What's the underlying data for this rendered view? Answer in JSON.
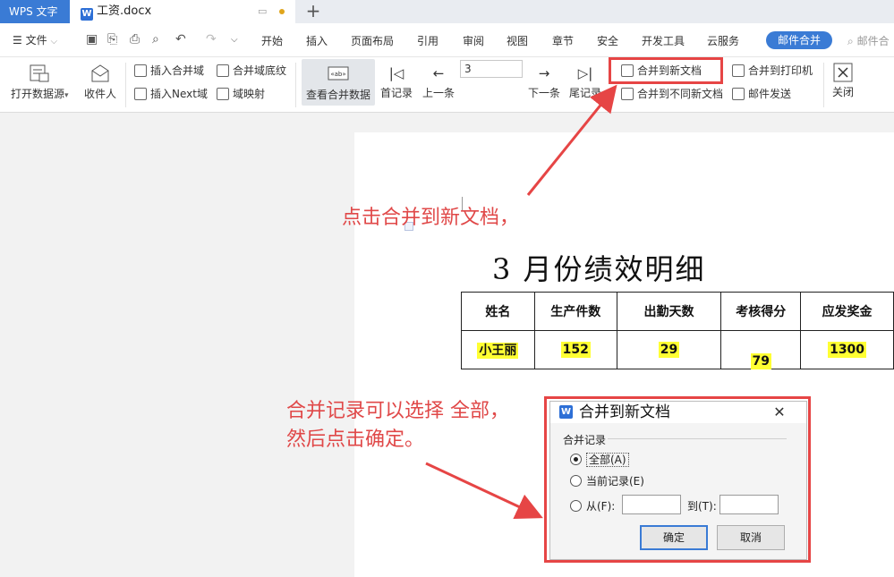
{
  "titlebar": {
    "app_name": "WPS 文字",
    "doc_tab": "工资.docx",
    "new_tab": "+"
  },
  "menubar": {
    "file_label": "文件",
    "items": [
      "开始",
      "插入",
      "页面布局",
      "引用",
      "审阅",
      "视图",
      "章节",
      "安全",
      "开发工具",
      "云服务"
    ],
    "active_tab": "邮件合并",
    "search_placeholder": "邮件合"
  },
  "ribbon": {
    "open_data_source": "打开数据源",
    "recipients": "收件人",
    "insert_merge_field": "插入合并域",
    "merge_field_shading": "合并域底纹",
    "insert_next_field": "插入Next域",
    "field_mapping": "域映射",
    "view_merged_data": "查看合并数据",
    "first_record": "首记录",
    "prev_record": "上一条",
    "record_number": "3",
    "next_record": "下一条",
    "last_record": "尾记录",
    "merge_to_new_doc": "合并到新文档",
    "merge_to_diff_docs": "合并到不同新文档",
    "merge_to_printer": "合并到打印机",
    "send_mail": "邮件发送",
    "close": "关闭"
  },
  "document": {
    "title": "3 月份绩效明细",
    "headers": [
      "姓名",
      "生产件数",
      "出勤天数",
      "考核得分",
      "应发奖金"
    ],
    "row": [
      "小王丽",
      "152",
      "29",
      "79",
      "1300"
    ]
  },
  "annotations": {
    "first": "点击合并到新文档，",
    "second_line1": "合并记录可以选择 全部，",
    "second_line2": "然后点击确定。"
  },
  "dialog": {
    "title": "合并到新文档",
    "close": "✕",
    "group_label": "合并记录",
    "option_all": "全部(A)",
    "option_current": "当前记录(E)",
    "option_from": "从(F):",
    "to_label": "到(T):",
    "ok": "确定",
    "cancel": "取消"
  },
  "colors": {
    "accent": "#3a7bd5",
    "annotation": "#e04848",
    "highlight": "#ffff33"
  }
}
